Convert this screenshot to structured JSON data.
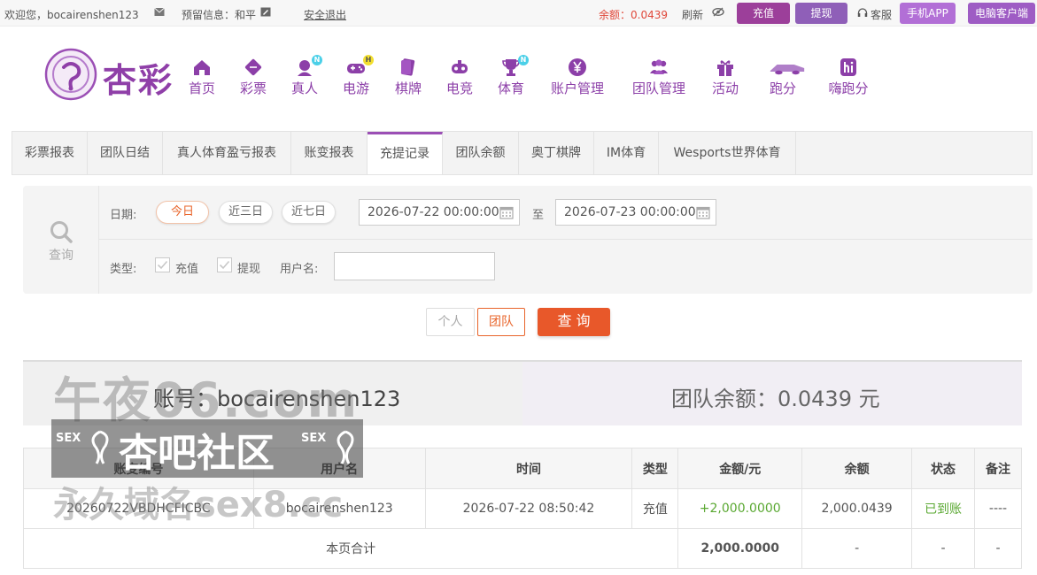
{
  "topbar": {
    "welcome": "欢迎您，bocairenshen123",
    "reserved": "预留信息：和平",
    "logout": "安全退出",
    "balance": "余额：0.0439",
    "refresh": "刷新",
    "deposit": "充值",
    "withdraw": "提现",
    "service": "客服",
    "mobile_app": "手机APP",
    "pc_client": "电脑客户端"
  },
  "brand": {
    "logo_text": "杏彩"
  },
  "nav": [
    {
      "label": "首页",
      "icon": "home-icon"
    },
    {
      "label": "彩票",
      "icon": "lottery-icon"
    },
    {
      "label": "真人",
      "icon": "live-dealer-icon",
      "badge": "N"
    },
    {
      "label": "电游",
      "icon": "gamepad-icon",
      "badge": "H"
    },
    {
      "label": "棋牌",
      "icon": "cards-icon"
    },
    {
      "label": "电竞",
      "icon": "esports-icon"
    },
    {
      "label": "体育",
      "icon": "trophy-icon",
      "badge": "N"
    },
    {
      "label": "账户管理",
      "icon": "yen-icon"
    },
    {
      "label": "团队管理",
      "icon": "team-icon"
    },
    {
      "label": "活动",
      "icon": "gift-icon"
    },
    {
      "label": "跑分",
      "icon": "car-icon"
    },
    {
      "label": "嗨跑分",
      "icon": "hi-icon"
    }
  ],
  "tabs": [
    "彩票报表",
    "团队日结",
    "真人体育盈亏报表",
    "账变报表",
    "充提记录",
    "团队余额",
    "奥丁棋牌",
    "IM体育",
    "Wesports世界体育"
  ],
  "active_tab": "充提记录",
  "filter": {
    "query_label": "查询",
    "date_label": "日期:",
    "ranges": [
      "今日",
      "近三日",
      "近七日"
    ],
    "date_from": "2026-07-22 00:00:00",
    "to_label": "至",
    "date_to": "2026-07-23 00:00:00",
    "type_label": "类型:",
    "type_deposit": "充值",
    "type_withdraw": "提现",
    "username_label": "用户名:",
    "username_value": ""
  },
  "buttons": {
    "personal": "个人",
    "team": "团队",
    "search": "查 询"
  },
  "summary": {
    "account": "账号：bocairenshen123",
    "team_balance": "团队余额：0.0439 元"
  },
  "table": {
    "headers": [
      "账变编号",
      "用户名",
      "时间",
      "类型",
      "金额/元",
      "余额",
      "状态",
      "备注"
    ],
    "rows": [
      [
        "20260722VBDHCFICBC",
        "bocairenshen123",
        "2026-07-22 08:50:42",
        "充值",
        "+2,000.0000",
        "2,000.0439",
        "已到账",
        "----"
      ]
    ],
    "total_label": "本页合计",
    "total_amount": "2,000.0000",
    "total_dash": "-"
  },
  "watermark": {
    "line1": "午夜06.com",
    "line2": "杏吧社区",
    "tag": "SEX",
    "line3": "永久域名sex8.cc"
  },
  "colors": {
    "brand_purple": "#8c3fa8",
    "accent_orange": "#e8642a",
    "balance_red": "#e0483a",
    "success_green": "#5aa832"
  }
}
